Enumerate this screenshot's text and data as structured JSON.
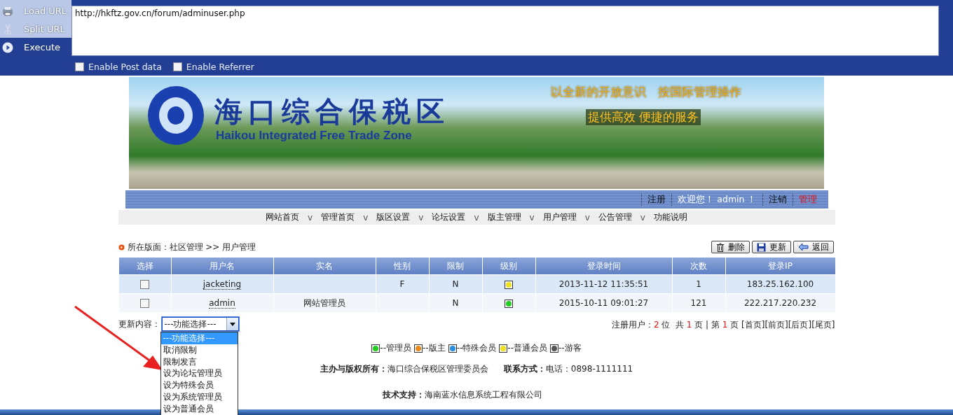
{
  "toolbar": {
    "actions": [
      {
        "label": "Load URL",
        "kind": "load"
      },
      {
        "label": "Split URL",
        "kind": "split"
      },
      {
        "label": "Execute",
        "kind": "execute"
      }
    ],
    "url": "http://hkftz.gov.cn/forum/adminuser.php",
    "options": [
      {
        "label": "Enable Post data",
        "checked": false
      },
      {
        "label": "Enable Referrer",
        "checked": false
      }
    ]
  },
  "banner": {
    "title": "海口综合保税区",
    "subtitle": "Haikou Integrated Free Trade Zone",
    "slogans": [
      "以全新的开放意识　按国际管理操作",
      "提供高效 便捷的服务"
    ]
  },
  "user_bar": [
    {
      "text": "注册",
      "kind": "link",
      "selected": false
    },
    {
      "text": "欢迎您！ admin ！",
      "kind": "greeting",
      "selected": false
    },
    {
      "text": "注销",
      "kind": "link",
      "selected": false
    },
    {
      "text": "管理",
      "kind": "link",
      "selected": true
    }
  ],
  "menu": [
    {
      "label": "网站首页",
      "caret": "v"
    },
    {
      "label": "管理首页",
      "caret": "v"
    },
    {
      "label": "版区设置",
      "caret": "v"
    },
    {
      "label": "论坛设置",
      "caret": "v"
    },
    {
      "label": "版主管理",
      "caret": "v"
    },
    {
      "label": "用户管理",
      "caret": "v"
    },
    {
      "label": "公告管理",
      "caret": "v"
    },
    {
      "label": "功能说明"
    }
  ],
  "breadcrumb": "所在版面：社区管理 >> 用户管理",
  "buttons": [
    {
      "label": "删除",
      "kind": "delete"
    },
    {
      "label": "更新",
      "kind": "save"
    },
    {
      "label": "返回",
      "kind": "back"
    }
  ],
  "table": {
    "columns": [
      "选择",
      "用户名",
      "实名",
      "性别",
      "限制",
      "级别",
      "登录时间",
      "次数",
      "登录IP"
    ],
    "rows": [
      {
        "checked": false,
        "username": "jacketing",
        "realname": "",
        "gender": "F",
        "restricted": "N",
        "color": "#f0e020",
        "login_time": "2013-11-12 11:35:51",
        "count": "1",
        "ip": "183.25.162.100"
      },
      {
        "checked": false,
        "username": "admin",
        "realname": "网站管理员",
        "gender": "",
        "restricted": "N",
        "color": "#22cc22",
        "login_time": "2015-10-11 09:01:27",
        "count": "121",
        "ip": "222.217.220.232"
      }
    ]
  },
  "update": {
    "label": "更新内容：",
    "value": "---功能选择---",
    "expanded": true,
    "options": [
      {
        "label": "---功能选择---",
        "selected": true
      },
      {
        "label": "取消限制",
        "selected": false
      },
      {
        "label": "限制发言",
        "selected": false
      },
      {
        "label": "设为论坛管理员",
        "selected": false
      },
      {
        "label": "设为特殊会员",
        "selected": false
      },
      {
        "label": "设为系统管理员",
        "selected": false
      },
      {
        "label": "设为普通会员",
        "selected": false
      }
    ]
  },
  "pagination": [
    {
      "text": "注册用户：",
      "kind": "plain"
    },
    {
      "text": "2",
      "kind": "count"
    },
    {
      "text": " 位  共 ",
      "kind": "plain"
    },
    {
      "text": "1",
      "kind": "count"
    },
    {
      "text": " 页 | 第 ",
      "kind": "plain"
    },
    {
      "text": "1",
      "kind": "count"
    },
    {
      "text": " 页 [首页][前页][后页][尾页]",
      "kind": "plain"
    }
  ],
  "legend": [
    {
      "label": "--管理员",
      "color": "#22cc22"
    },
    {
      "label": "--版主",
      "color": "#e88a1a"
    },
    {
      "label": "--特殊会员",
      "color": "#2a8ee0"
    },
    {
      "label": "--普通会员",
      "color": "#f0e020"
    },
    {
      "label": "--游客",
      "color": "#555555"
    }
  ],
  "footer": {
    "owner": "**主办与版权所有：**海口综合保税区管理委员会",
    "contact": "**联系方式：**电话：0898-1111111",
    "support": "**技术支持：**海南蓝水信息系统工程有限公司"
  }
}
